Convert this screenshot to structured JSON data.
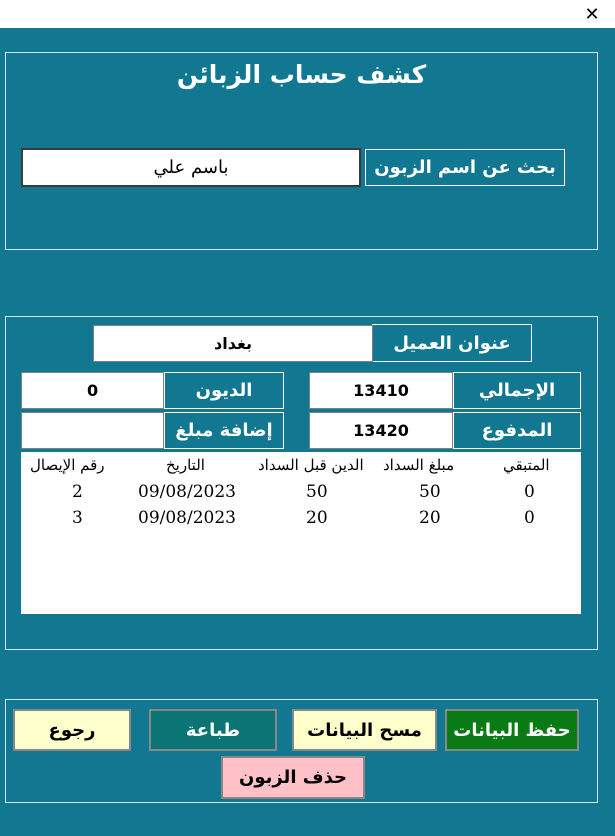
{
  "window": {
    "close_symbol": "✕"
  },
  "header": {
    "title": "كشف حساب الزبائن"
  },
  "search": {
    "label": "بحث عن اسم الزبون",
    "value": "باسم علي"
  },
  "customer": {
    "address_label": "عنوان العميل",
    "address_value": "بغداد",
    "total_label": "الإجمالي",
    "total_value": "13410",
    "paid_label": "المدفوع",
    "paid_value": "13420",
    "debts_label": "الديون",
    "debts_value": "0",
    "add_amount_label": "إضافة مبلغ",
    "add_amount_value": ""
  },
  "table": {
    "columns": [
      "المتبقي",
      "مبلغ السداد",
      "الدين قبل السداد",
      "التاريخ",
      "رقم الإيصال"
    ],
    "rows": [
      [
        "0",
        "50",
        "50",
        "09/08/2023",
        "2"
      ],
      [
        "0",
        "20",
        "20",
        "09/08/2023",
        "3"
      ]
    ]
  },
  "buttons": {
    "save": "حفظ البيانات",
    "clear": "مسح البيانات",
    "print": "طباعة",
    "back": "رجوع",
    "delete": "حذف الزبون"
  },
  "colors": {
    "form_bg": "#127891",
    "save_bg": "#0a7a14",
    "clear_bg": "#ffffcc",
    "print_bg": "#0b7474",
    "back_bg": "#ffffcc",
    "delete_bg": "#ffc0c8"
  }
}
